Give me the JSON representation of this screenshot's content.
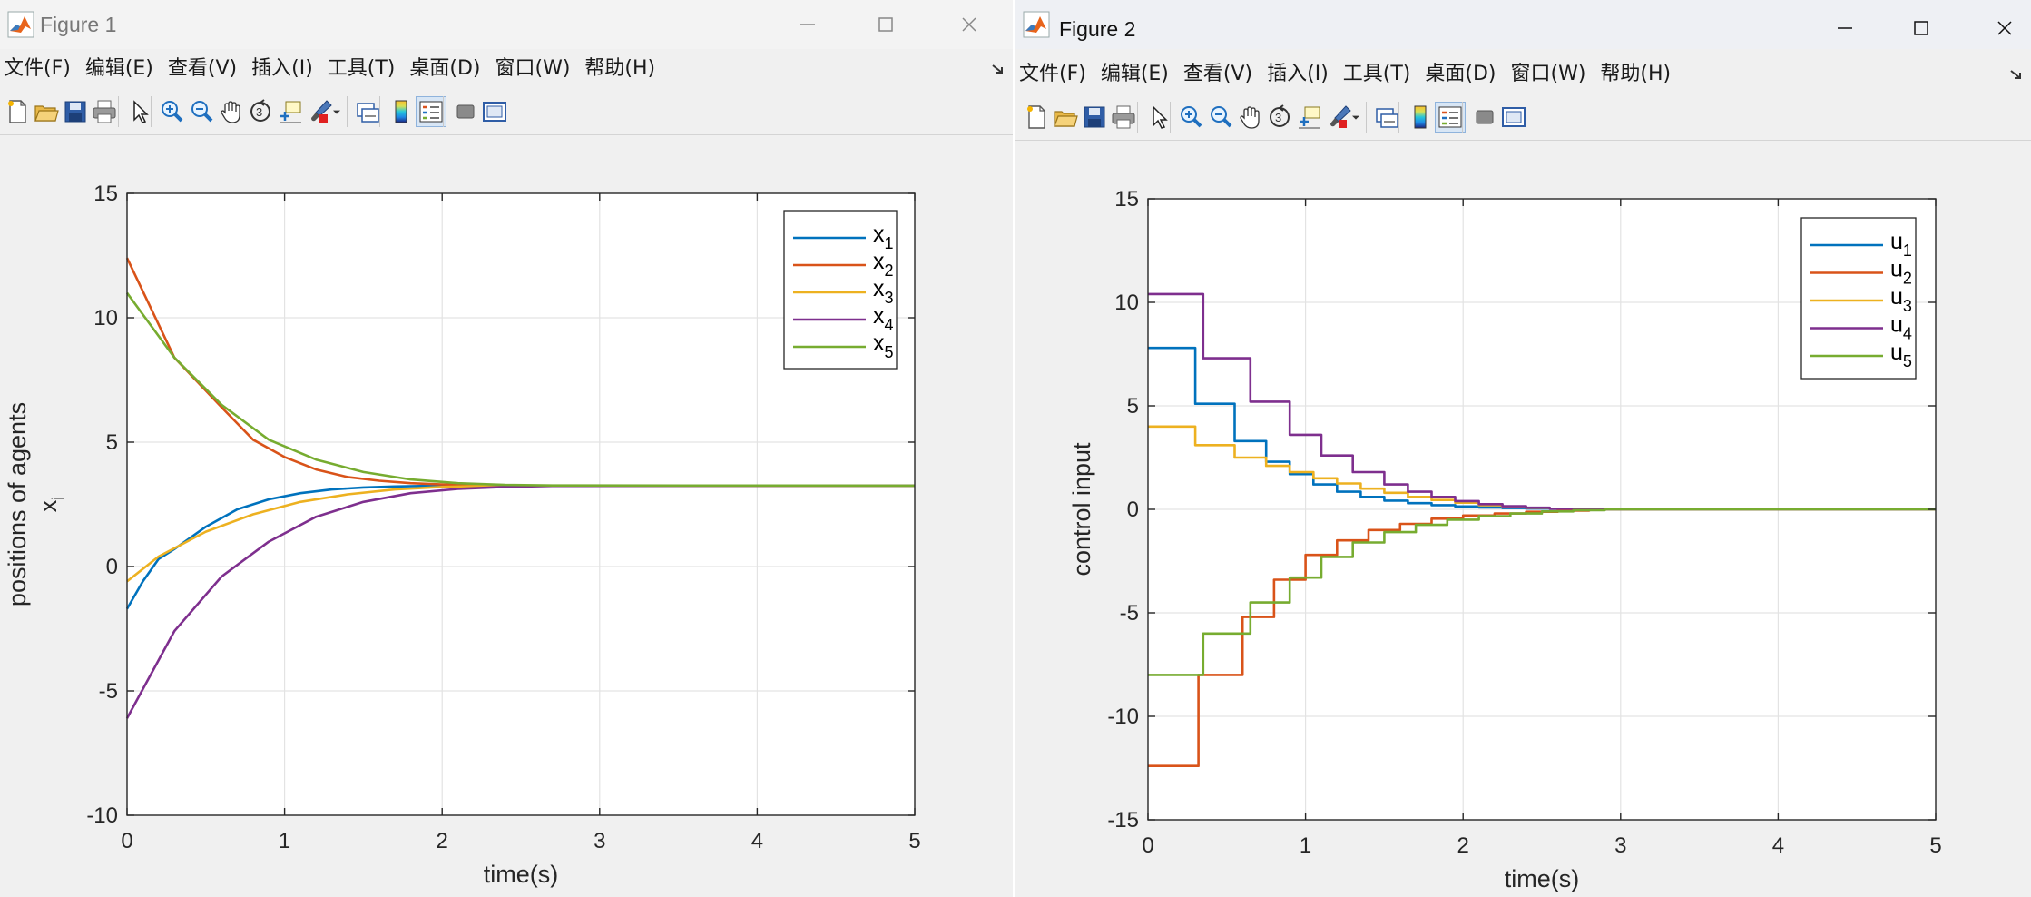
{
  "menu": [
    "文件(F)",
    "编辑(E)",
    "查看(V)",
    "插入(I)",
    "工具(T)",
    "桌面(D)",
    "窗口(W)",
    "帮助(H)"
  ],
  "toolbar_icons": [
    "new-file-icon",
    "open-folder-icon",
    "save-icon",
    "print-icon",
    "pointer-icon",
    "zoom-in-icon",
    "zoom-out-icon",
    "pan-hand-icon",
    "rotate-3d-icon",
    "data-cursor-icon",
    "brush-icon",
    "brush-dropdown-icon",
    "link-plot-icon",
    "colorbar-icon",
    "legend-icon",
    "hide-plot-tools-icon",
    "show-plot-tools-icon"
  ],
  "colors": {
    "s1": "#0072BD",
    "s2": "#D95319",
    "s3": "#EDB120",
    "s4": "#7E2F8E",
    "s5": "#77AC30"
  },
  "figure1": {
    "title": "Figure 1",
    "chart_data": {
      "type": "line",
      "xlabel": "time(s)",
      "ylabel_line1": "positions of agents",
      "ylabel_var": "x",
      "ylabel_sub": "i",
      "xlim": [
        0,
        5
      ],
      "ylim": [
        -10,
        15
      ],
      "xticks": [
        0,
        1,
        2,
        3,
        4,
        5
      ],
      "yticks": [
        -10,
        -5,
        0,
        5,
        10,
        15
      ],
      "grid": true,
      "legend_position": "top-right",
      "series": [
        {
          "name": "x",
          "sub": "1",
          "x": [
            0,
            0.1,
            0.2,
            0.3,
            0.5,
            0.7,
            0.9,
            1.1,
            1.3,
            1.5,
            1.7,
            1.9,
            2.1,
            2.3,
            2.5,
            5
          ],
          "y": [
            -1.7,
            -0.6,
            0.3,
            0.7,
            1.6,
            2.3,
            2.7,
            2.95,
            3.1,
            3.18,
            3.22,
            3.24,
            3.25,
            3.25,
            3.25,
            3.25
          ]
        },
        {
          "name": "x",
          "sub": "2",
          "x": [
            0,
            0.3,
            0.6,
            0.8,
            1.0,
            1.2,
            1.4,
            1.6,
            1.8,
            2.0,
            2.2,
            2.4,
            2.6,
            5
          ],
          "y": [
            12.4,
            8.4,
            6.4,
            5.1,
            4.4,
            3.9,
            3.6,
            3.45,
            3.35,
            3.3,
            3.27,
            3.26,
            3.25,
            3.25
          ]
        },
        {
          "name": "x",
          "sub": "3",
          "x": [
            0,
            0.2,
            0.5,
            0.8,
            1.1,
            1.4,
            1.7,
            2.0,
            2.3,
            2.6,
            5
          ],
          "y": [
            -0.6,
            0.4,
            1.4,
            2.1,
            2.6,
            2.9,
            3.1,
            3.2,
            3.24,
            3.25,
            3.25
          ]
        },
        {
          "name": "x",
          "sub": "4",
          "x": [
            0,
            0.3,
            0.6,
            0.9,
            1.2,
            1.5,
            1.8,
            2.1,
            2.4,
            2.7,
            5
          ],
          "y": [
            -6.1,
            -2.6,
            -0.4,
            1.0,
            2.0,
            2.6,
            2.95,
            3.12,
            3.2,
            3.24,
            3.25
          ]
        },
        {
          "name": "x",
          "sub": "5",
          "x": [
            0,
            0.3,
            0.6,
            0.9,
            1.2,
            1.5,
            1.8,
            2.1,
            2.4,
            2.7,
            5
          ],
          "y": [
            11.0,
            8.4,
            6.5,
            5.1,
            4.3,
            3.8,
            3.5,
            3.35,
            3.28,
            3.26,
            3.25
          ]
        }
      ]
    }
  },
  "figure2": {
    "title": "Figure 2",
    "chart_data": {
      "type": "line",
      "step": true,
      "xlabel": "time(s)",
      "ylabel": "control input",
      "xlim": [
        0,
        5
      ],
      "ylim": [
        -15,
        15
      ],
      "xticks": [
        0,
        1,
        2,
        3,
        4,
        5
      ],
      "yticks": [
        -15,
        -10,
        -5,
        0,
        5,
        10,
        15
      ],
      "grid": true,
      "legend_position": "top-right",
      "series": [
        {
          "name": "u",
          "sub": "1",
          "t": [
            0,
            0.3,
            0.55,
            0.75,
            0.9,
            1.05,
            1.2,
            1.35,
            1.5,
            1.65,
            1.8,
            1.95,
            2.1,
            2.25,
            2.4,
            2.55,
            2.7
          ],
          "values": [
            7.8,
            5.1,
            3.3,
            2.3,
            1.7,
            1.2,
            0.85,
            0.6,
            0.42,
            0.3,
            0.2,
            0.14,
            0.09,
            0.06,
            0.04,
            0.02,
            0.0
          ]
        },
        {
          "name": "u",
          "sub": "2",
          "t": [
            0,
            0.32,
            0.6,
            0.8,
            1.0,
            1.2,
            1.4,
            1.6,
            1.8,
            2.0,
            2.2,
            2.4,
            2.6,
            2.8
          ],
          "values": [
            -12.4,
            -8.0,
            -5.2,
            -3.4,
            -2.2,
            -1.5,
            -1.0,
            -0.7,
            -0.45,
            -0.3,
            -0.2,
            -0.12,
            -0.06,
            0.0
          ]
        },
        {
          "name": "u",
          "sub": "3",
          "t": [
            0,
            0.3,
            0.55,
            0.75,
            0.9,
            1.05,
            1.2,
            1.35,
            1.5,
            1.65,
            1.8,
            1.95,
            2.1,
            2.25,
            2.4,
            2.55,
            2.7
          ],
          "values": [
            4.0,
            3.1,
            2.5,
            2.1,
            1.8,
            1.5,
            1.25,
            1.0,
            0.8,
            0.6,
            0.45,
            0.32,
            0.2,
            0.12,
            0.07,
            0.03,
            0.0
          ]
        },
        {
          "name": "u",
          "sub": "4",
          "t": [
            0,
            0.35,
            0.65,
            0.9,
            1.1,
            1.3,
            1.5,
            1.65,
            1.8,
            1.95,
            2.1,
            2.25,
            2.4,
            2.55,
            2.7
          ],
          "values": [
            10.4,
            7.3,
            5.2,
            3.6,
            2.6,
            1.8,
            1.2,
            0.85,
            0.6,
            0.4,
            0.25,
            0.15,
            0.08,
            0.03,
            0.0
          ]
        },
        {
          "name": "u",
          "sub": "5",
          "t": [
            0,
            0.35,
            0.65,
            0.9,
            1.1,
            1.3,
            1.5,
            1.7,
            1.9,
            2.1,
            2.3,
            2.5,
            2.7,
            2.9
          ],
          "values": [
            -8.0,
            -6.0,
            -4.5,
            -3.3,
            -2.3,
            -1.6,
            -1.1,
            -0.75,
            -0.5,
            -0.33,
            -0.2,
            -0.1,
            -0.04,
            0.0
          ]
        }
      ]
    }
  }
}
